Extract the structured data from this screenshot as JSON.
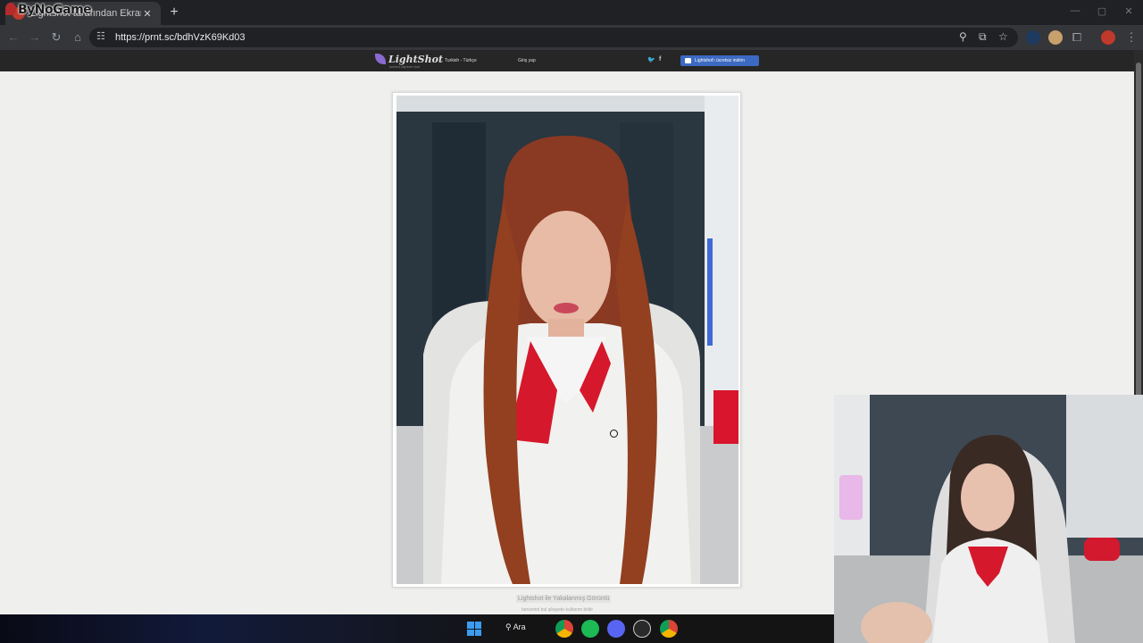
{
  "browser": {
    "tab_title": "Lightshot tarafından Ekran Görüntüsü",
    "overlay_brand": "ByNoGame",
    "url": "https://prnt.sc/bdhVzK69Kd03"
  },
  "lightshot": {
    "logo": "LightShot",
    "tagline": "screen capture tool",
    "language": "Turkish - Türkçe",
    "login": "Giriş yap",
    "download_button": "Lightshot'ı ücretsiz indirin",
    "caption": "Lightshot ile Yakalanmış Görüntü",
    "caption_sub": "benzerini bul   şikayete kullanım bildir"
  },
  "taskbar": {
    "search_label": "Ara"
  },
  "icons": [
    "back-icon",
    "forward-icon",
    "reload-icon",
    "home-icon",
    "site-settings-icon",
    "zoom-icon",
    "install-icon",
    "bookmark-star-icon",
    "extensions-icon",
    "menu-icon",
    "windows-start-icon",
    "search-icon",
    "chrome-icon",
    "spotify-icon",
    "discord-icon",
    "steam-icon"
  ]
}
